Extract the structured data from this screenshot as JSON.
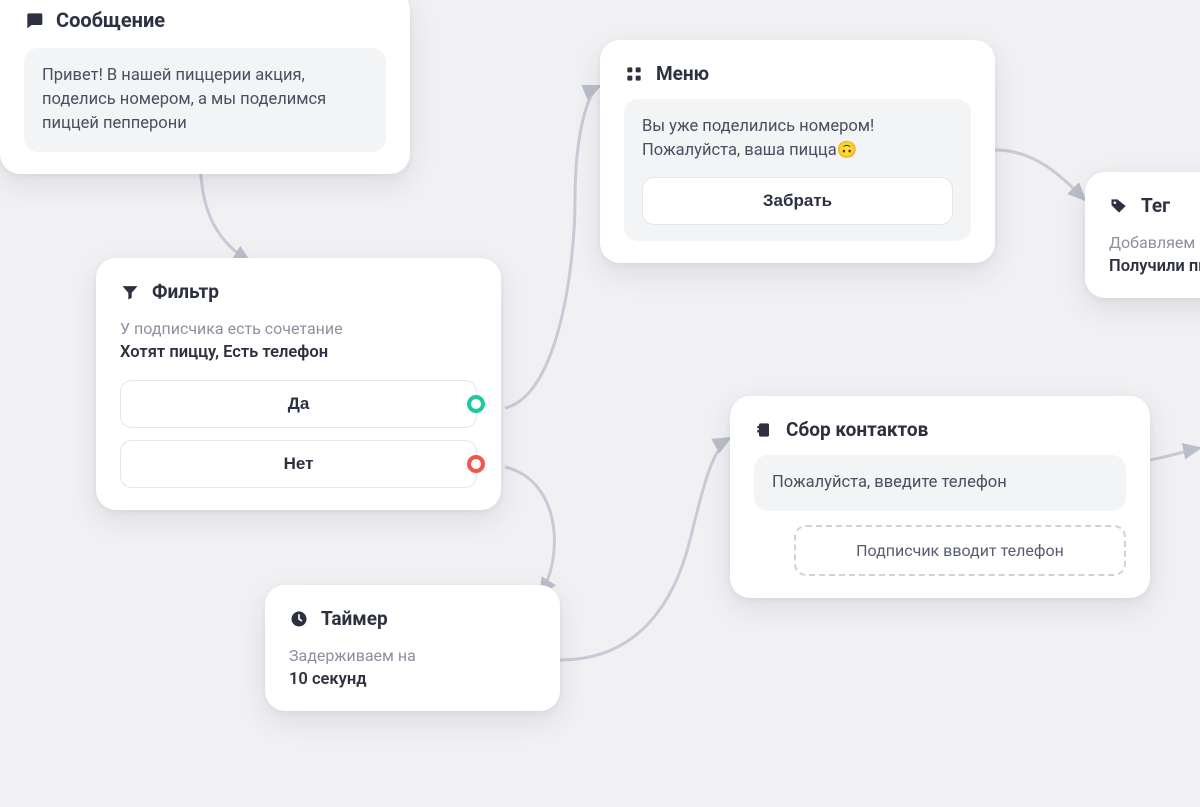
{
  "message": {
    "title": "Сообщение",
    "body": "Привет! В нашей пиццерии акция, поделись номером, а мы поделимся пиццей пепперони"
  },
  "filter": {
    "title": "Фильтр",
    "subtitle": "У подписчика есть сочетание",
    "condition": "Хотят пиццу, Есть телефон",
    "yes": "Да",
    "no": "Нет"
  },
  "menu": {
    "title": "Меню",
    "body": "Вы уже поделились номером! Пожалуйста, ваша пицца🙃",
    "button": "Забрать"
  },
  "timer": {
    "title": "Таймер",
    "subtitle": "Задерживаем на",
    "value": "10 секунд"
  },
  "collect": {
    "title": "Сбор контактов",
    "prompt": "Пожалуйста, введите телефон",
    "action": "Подписчик вводит телефон"
  },
  "tag": {
    "title": "Тег",
    "subtitle": "Добавляем",
    "value": "Получили пи"
  }
}
